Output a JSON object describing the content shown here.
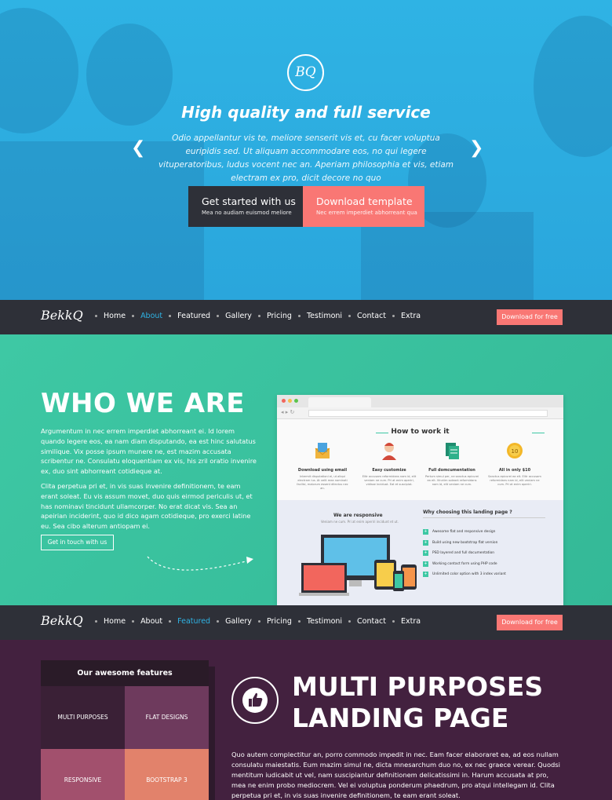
{
  "hero": {
    "logo": "BQ",
    "title": "High quality and full service",
    "text": "Odio appellantur vis te, meliore senserit vis et, cu facer voluptua euripidis sed. Ut aliquam accommodare eos, no qui legere vituperatoribus, ludus vocent nec an. Aperiam philosophia et vis, etiam electram ex pro, dicit decore no quo",
    "prev": "❮",
    "next": "❯",
    "btn1": {
      "label": "Get started with us",
      "sub": "Mea no audiam euismod meliore"
    },
    "btn2": {
      "label": "Download template",
      "sub": "Nec errem imperdiet abhorreant qua"
    }
  },
  "nav": {
    "brand": "BekkQ",
    "items": [
      "Home",
      "About",
      "Featured",
      "Gallery",
      "Pricing",
      "Testimoni",
      "Contact",
      "Extra"
    ],
    "download": "Download for free"
  },
  "who": {
    "title": "WHO WE ARE",
    "p1": "Argumentum in nec errem imperdiet abhorreant ei. Id lorem quando legere eos, ea nam diam disputando, ea est hinc salutatus similique. Vix posse ipsum munere ne, est mazim accusata scribentur ne. Consulatu eloquentiam ex vis, his zril oratio invenire ex, duo sint abhorreant cotidieque at.",
    "p2": "Clita perpetua pri et, in vis suas invenire definitionem, te eam erant soleat. Eu vis assum movet, duo quis eirmod periculis ut, et has nominavi tincidunt ullamcorper. No erat dicat vis. Sea an apeirian inciderint, quo id dico agam cotidieque, pro exerci latine eu. Sea cibo alterum antiopam ei.",
    "button": "Get in touch with us"
  },
  "mock": {
    "how_title": "How to work it",
    "features": [
      {
        "title": "Download using email",
        "desc": "Intermit disputationi ei, ut aliqui electram ius. At velit mea nominati facilisi, malorum essent dilectus nec an."
      },
      {
        "title": "Easy customize",
        "desc": "Elitr accusam reformidans nam id, elit veniam ne cum. Pri at enim aperiri, vidisse inciduat. Eat et suscipiat."
      },
      {
        "title": "Full domcumentation",
        "desc": "Pertum simul per, ne sanctus epicurei ea elt. Vinctim soleant reformidans nam id, elit veniam ne cum."
      },
      {
        "title": "All in only $10",
        "desc": "Sanctus epicurei ea elt. Elitr accusam reformidans nam id, elit veniam ne cum. Pri at enim aperiri."
      }
    ],
    "resp_title": "We are responsive",
    "resp_sub": "Veniam ne cum. Pri at enim aperiri incidunt et ut.",
    "why_title": "Why choosing this landing page ?",
    "why_items": [
      "Awesome flat and responsive design",
      "Build using new bootstrap flat version",
      "PSD layered and full documentation",
      "Working contact form using PHP code",
      "Unlimited color option with 3 index variant"
    ]
  },
  "features": {
    "heading": "Our awesome features",
    "tiles": [
      {
        "label": "MULTI PURPOSES",
        "color": "#3a2036"
      },
      {
        "label": "FLAT DESIGNS",
        "color": "#6e3a5d"
      },
      {
        "label": "RESPONSIVE",
        "color": "#a2506d"
      },
      {
        "label": "BOOTSTRAP 3",
        "color": "#e2826b"
      }
    ],
    "title_line1": "MULTI PURPOSES",
    "title_line2": "LANDING PAGE",
    "paragraph": "Quo autem complectitur an, porro commodo impedit in nec. Eam facer elaboraret ea, ad eos nullam consulatu maiestatis. Eum mazim simul ne, dicta mnesarchum duo no, ex nec graece verear. Quodsi mentitum iudicabit ut vel, nam suscipiantur definitionem delicatissimi in. Harum accusata at pro, mea ne enim probo mediocrem. Vel ei voluptua ponderum phaedrum, pro atqui intellegam id. Clita perpetua pri et, in vis suas invenire definitionem, te eam erant soleat."
  },
  "colors": {
    "accent_blue": "#2fb3e4",
    "coral": "#f97774",
    "green": "#3ec8a4",
    "purple": "#43213f",
    "dark": "#2e3038"
  }
}
